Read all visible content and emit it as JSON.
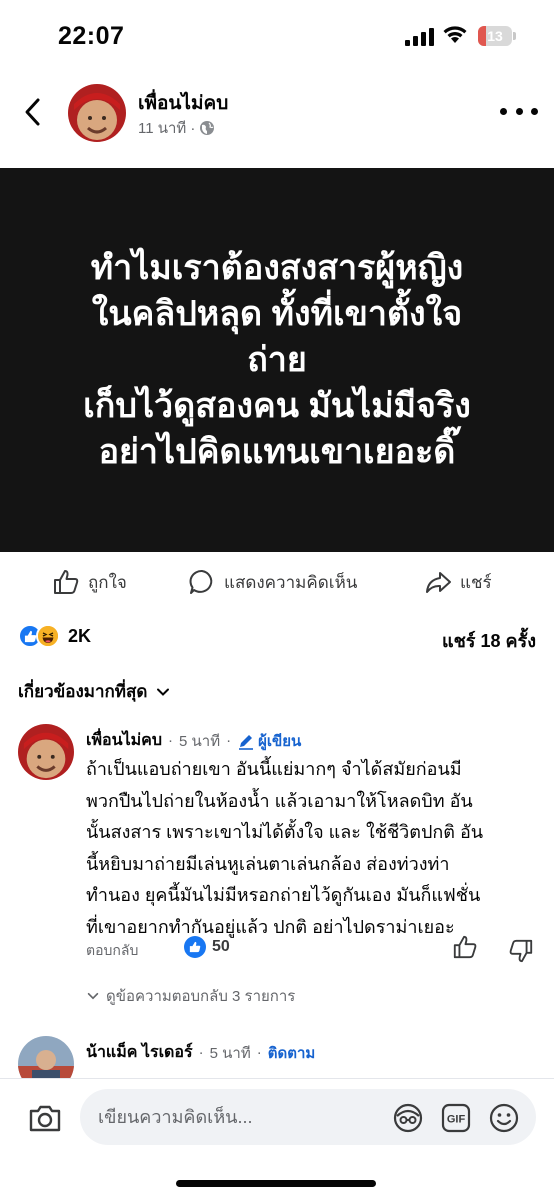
{
  "status_bar": {
    "time": "22:07",
    "battery": "13"
  },
  "post": {
    "author": "เพื่อนไม่คบ",
    "meta_time": "11 นาที",
    "image_text": "ทำไมเราต้องสงสารผู้หญิง\nในคลิปหลุด ทั้งที่เขาตั้งใจ\nถ่าย\nเก็บไว้ดูสองคน มันไม่มีจริง\nอย่าไปคิดแทนเขาเยอะดิ๊"
  },
  "actions": {
    "like": "ถูกใจ",
    "comment": "แสดงความคิดเห็น",
    "share": "แชร์"
  },
  "stats": {
    "reaction_count": "2K",
    "share_count": "แชร์ 18 ครั้ง"
  },
  "sort": {
    "label": "เกี่ยวข้องมากที่สุด"
  },
  "comments": [
    {
      "author": "เพื่อนไม่คบ",
      "time": "5 นาที",
      "badge": "ผู้เขียน",
      "text": "ถ้าเป็นแอบถ่ายเขา อันนี้แย่มากๆ จำได้สมัยก่อนมี\nพวกปืนไปถ่ายในห้องน้ำ แล้วเอามาให้โหลดบิท อัน\nนั้นสงสาร เพราะเขาไม่ได้ตั้งใจ และ ใช้ชีวิตปกติ อัน\nนี้หยิบมาถ่ายมีเล่นหูเล่นตาเล่นกล้อง ส่องท่วงท่า\nทำนอง ยุคนี้มันไม่มีหรอกถ่ายไว้ดูกันเอง มันก็แฟชั่น\nที่เขาอยากทำกันอยู่แล้ว ปกติ อย่าไปดราม่าเยอะ",
      "reply_label": "ตอบกลับ",
      "likes": "50",
      "view_replies": "ดูข้อความตอบกลับ 3 รายการ"
    },
    {
      "author": "น้าแม็ค ไรเดอร์",
      "time": "5 นาที",
      "follow": "ติดตาม"
    }
  ],
  "composer": {
    "placeholder": "เขียนความคิดเห็น..."
  },
  "colors": {
    "accent": "#1877f2",
    "badge_blue": "#1763cf",
    "post_bg": "#141414",
    "muted": "#65676b"
  }
}
